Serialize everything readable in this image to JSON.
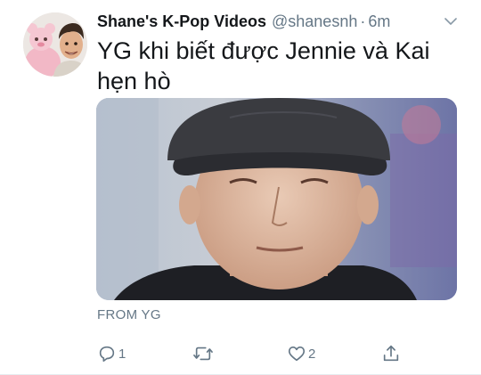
{
  "author": {
    "display_name": "Shane's K-Pop Videos",
    "handle": "@shanesnh",
    "separator": "·",
    "time": "6m"
  },
  "tweet": {
    "text": "YG khi biết được Jennie và Kai hẹn hò"
  },
  "media": {
    "caption": "FROM YG"
  },
  "actions": {
    "reply_count": "1",
    "retweet_count": "",
    "like_count": "2"
  },
  "icons": {
    "reply": "comment-icon",
    "retweet": "retweet-icon",
    "like": "heart-icon",
    "share": "share-icon",
    "more": "chevron-down-icon"
  },
  "colors": {
    "text": "#14171a",
    "secondary": "#657786",
    "divider": "#e6ecf0"
  }
}
